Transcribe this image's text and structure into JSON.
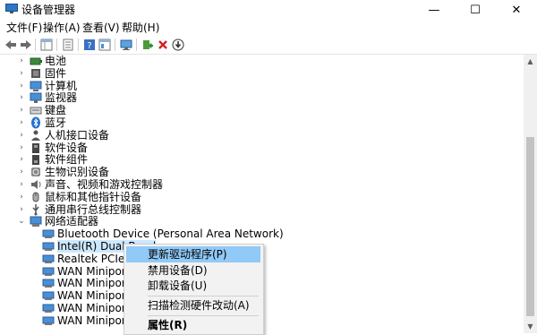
{
  "window": {
    "title": "设备管理器",
    "minimize_glyph": "—",
    "maximize_glyph": "☐",
    "close_glyph": "✕"
  },
  "menu": [
    "文件(F)",
    "操作(A)",
    "查看(V)",
    "帮助(H)"
  ],
  "toolbar": [
    "back-arrow-icon",
    "forward-arrow-icon",
    "properties-grid-icon",
    "document-list-icon",
    "help-icon",
    "console-tree-icon",
    "monitor-scan-icon",
    "add-driver-icon",
    "uninstall-x-icon",
    "disable-down-icon"
  ],
  "tree": {
    "categories": [
      {
        "label": "电池",
        "icon": "battery-icon"
      },
      {
        "label": "固件",
        "icon": "firmware-icon"
      },
      {
        "label": "计算机",
        "icon": "computer-icon"
      },
      {
        "label": "监视器",
        "icon": "monitor-icon"
      },
      {
        "label": "键盘",
        "icon": "keyboard-icon"
      },
      {
        "label": "蓝牙",
        "icon": "bluetooth-icon"
      },
      {
        "label": "人机接口设备",
        "icon": "hid-icon"
      },
      {
        "label": "软件设备",
        "icon": "software-device-icon"
      },
      {
        "label": "软件组件",
        "icon": "software-component-icon"
      },
      {
        "label": "生物识别设备",
        "icon": "biometric-icon"
      },
      {
        "label": "声音、视频和游戏控制器",
        "icon": "sound-icon"
      },
      {
        "label": "鼠标和其他指针设备",
        "icon": "mouse-icon"
      },
      {
        "label": "通用串行总线控制器",
        "icon": "usb-icon"
      },
      {
        "label": "网络适配器",
        "icon": "network-adapter-icon"
      }
    ],
    "network_children": [
      "Bluetooth Device (Personal Area Network)",
      "Intel(R) Dual Band",
      "Realtek PCIe GbE",
      "WAN Miniport (IK",
      "WAN Miniport (IP",
      "WAN Miniport (IP",
      "WAN Miniport (L2",
      "WAN Miniport (N"
    ],
    "expand_glyph": "›",
    "expanded_glyph": "⌄"
  },
  "context_menu": {
    "items": [
      "更新驱动程序(P)",
      "禁用设备(D)",
      "卸载设备(U)",
      "扫描检测硬件改动(A)",
      "属性(R)"
    ]
  },
  "scrollbar": {
    "up": "▲",
    "down": "▼"
  }
}
